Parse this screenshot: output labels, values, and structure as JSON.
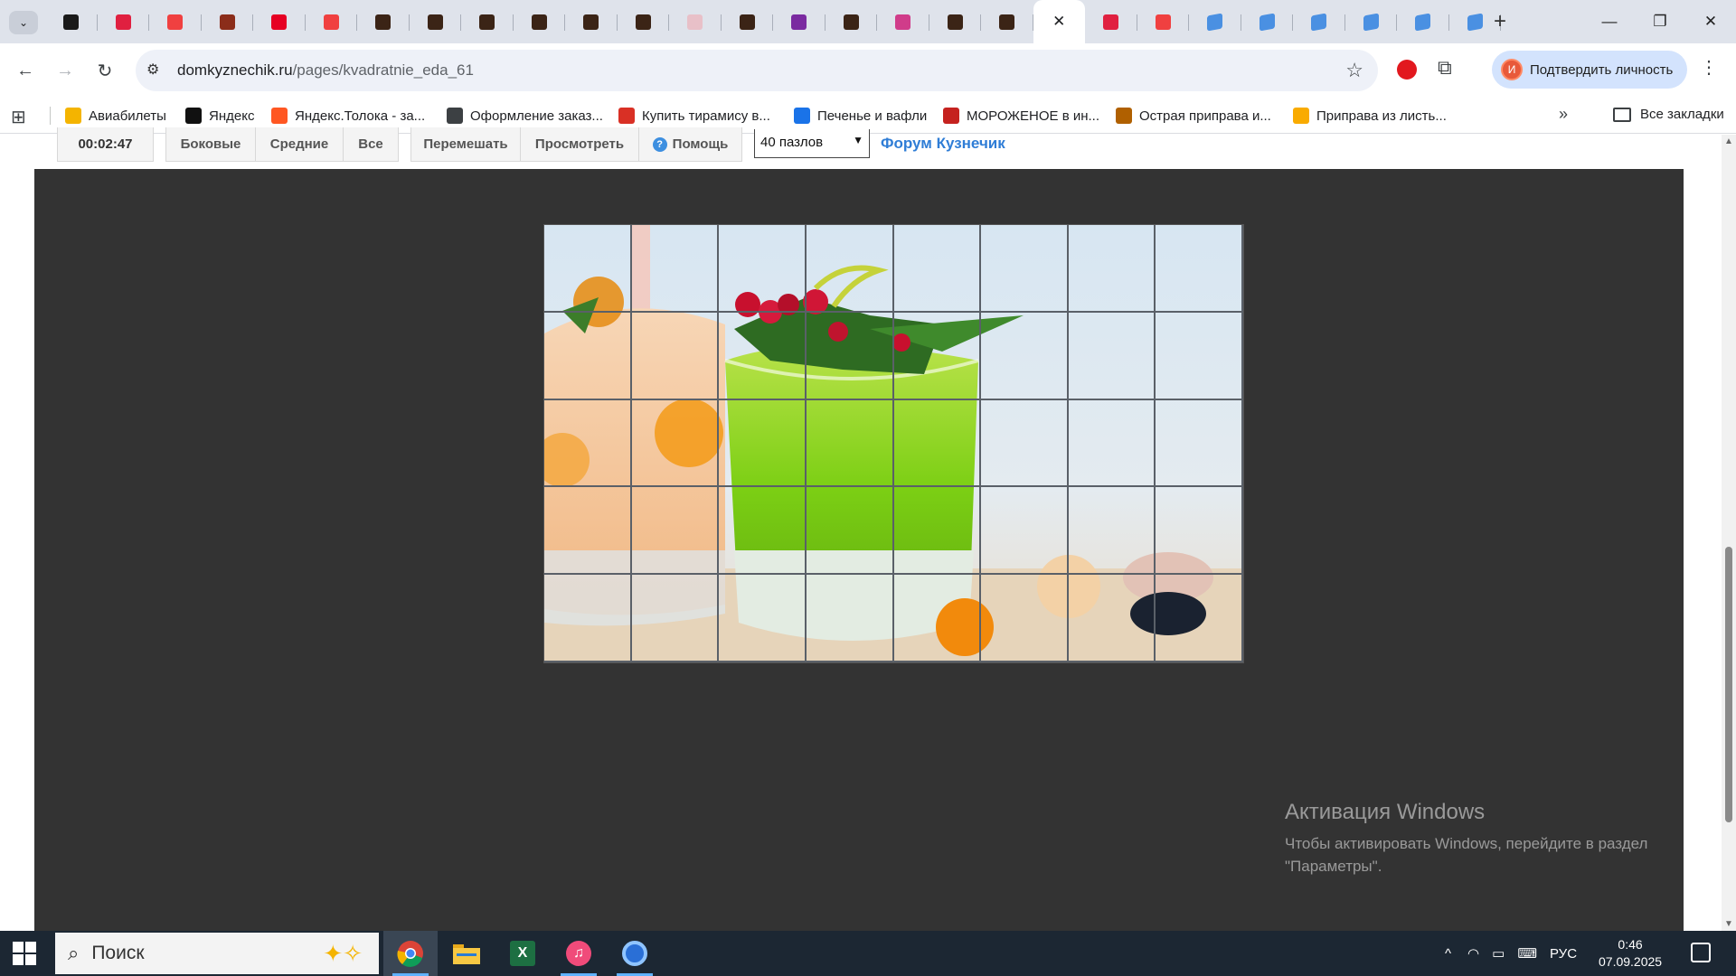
{
  "browser": {
    "tabs_collapsed_icon": "chevron-down-icon",
    "tab_count": 28,
    "active_tab_close": "✕",
    "new_tab": "+",
    "window_controls": [
      "—",
      "❐",
      "✕"
    ],
    "url_host": "domkyznechik.ru",
    "url_path": "/pages/kvadratnie_eda_61",
    "profile_label": "Подтвердить личность",
    "profile_initial": "И"
  },
  "bookmarks": {
    "items": [
      {
        "label": "Авиабилеты",
        "color": "#f4b400"
      },
      {
        "label": "Яндекс",
        "color": "#111111"
      },
      {
        "label": "Яндекс.Толока - за...",
        "color": "#ff5722"
      },
      {
        "label": "Оформление заказ...",
        "color": "#3c4043"
      },
      {
        "label": "Купить тирамису в...",
        "color": "#d93025"
      },
      {
        "label": "Печенье и вафли",
        "color": "#1a73e8"
      },
      {
        "label": "МОРОЖЕНОЕ в ин...",
        "color": "#c5221f"
      },
      {
        "label": "Острая приправа и...",
        "color": "#b06000"
      },
      {
        "label": "Приправа из листь...",
        "color": "#f9ab00"
      }
    ],
    "more": "»",
    "all": "Все закладки"
  },
  "puzzle_controls": {
    "timer": "00:02:47",
    "edges": "Боковые",
    "middles": "Средние",
    "all": "Все",
    "shuffle": "Перемешать",
    "preview": "Просмотреть",
    "help": "Помощь",
    "pieces_select": "40 пазлов",
    "forum": "Форум Кузнечик"
  },
  "puzzle": {
    "columns": 8,
    "rows": 5,
    "image_subject": "green cocktail with red berries and mint, orange drink, seashells"
  },
  "watermark": {
    "title": "Активация Windows",
    "line1": "Чтобы активировать Windows, перейдите в раздел",
    "line2": "\"Параметры\"."
  },
  "taskbar": {
    "search_placeholder": "Поиск",
    "language": "РУС",
    "time": "0:46",
    "date": "07.09.2025"
  }
}
